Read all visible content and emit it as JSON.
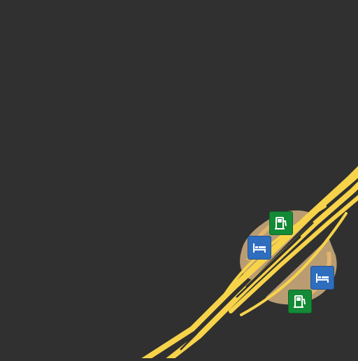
{
  "map": {
    "background_color": "#303030",
    "road_color": "#f7d34a",
    "road_edge_color": "#c9a93a",
    "service_area_color": "#e8c08a",
    "pois": [
      {
        "id": "fuel-north",
        "type": "fuel",
        "icon": "fuel-station-icon",
        "color": "#138a36"
      },
      {
        "id": "hotel-west",
        "type": "lodging",
        "icon": "bed-icon",
        "color": "#2f6ebf"
      },
      {
        "id": "hotel-east",
        "type": "lodging",
        "icon": "bed-icon",
        "color": "#2f6ebf"
      },
      {
        "id": "fuel-south",
        "type": "fuel",
        "icon": "fuel-station-icon",
        "color": "#138a36"
      }
    ]
  }
}
